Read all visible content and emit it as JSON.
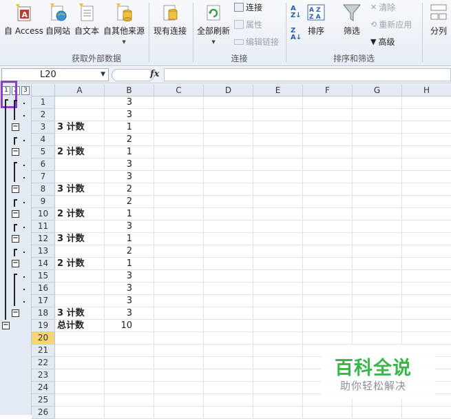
{
  "ribbon": {
    "groups": [
      {
        "label": "获取外部数据"
      },
      {
        "label": "连接"
      },
      {
        "label": "排序和筛选"
      }
    ],
    "buttons": {
      "access": "自 Access",
      "web": "自网站",
      "text": "自文本",
      "other": "自其他来源",
      "existing": "现有连接",
      "refresh_all": "全部刷新",
      "connections": "连接",
      "properties": "属性",
      "edit_links": "编辑链接",
      "sort": "排序",
      "filter": "筛选",
      "clear": "清除",
      "reapply": "重新应用",
      "advanced": "高级",
      "split": "分列"
    }
  },
  "formula_bar": {
    "name_box": "L20",
    "fx": "fx",
    "formula": ""
  },
  "outline": {
    "levels": [
      "1",
      "2",
      "3"
    ]
  },
  "columns": [
    "A",
    "B",
    "C",
    "D",
    "E",
    "F",
    "G",
    "H"
  ],
  "active_row": "20",
  "rows": [
    {
      "num": "1",
      "a": "",
      "b": "3"
    },
    {
      "num": "2",
      "a": "",
      "b": "3"
    },
    {
      "num": "3",
      "a": "3 计数",
      "b": "1"
    },
    {
      "num": "4",
      "a": "",
      "b": "2"
    },
    {
      "num": "5",
      "a": "2 计数",
      "b": "1"
    },
    {
      "num": "6",
      "a": "",
      "b": "3"
    },
    {
      "num": "7",
      "a": "",
      "b": "3"
    },
    {
      "num": "8",
      "a": "3 计数",
      "b": "2"
    },
    {
      "num": "9",
      "a": "",
      "b": "2"
    },
    {
      "num": "10",
      "a": "2 计数",
      "b": "1"
    },
    {
      "num": "11",
      "a": "",
      "b": "3"
    },
    {
      "num": "12",
      "a": "3 计数",
      "b": "1"
    },
    {
      "num": "13",
      "a": "",
      "b": "2"
    },
    {
      "num": "14",
      "a": "2 计数",
      "b": "1"
    },
    {
      "num": "15",
      "a": "",
      "b": "3"
    },
    {
      "num": "16",
      "a": "",
      "b": "3"
    },
    {
      "num": "17",
      "a": "",
      "b": "3"
    },
    {
      "num": "18",
      "a": "3 计数",
      "b": "3"
    },
    {
      "num": "19",
      "a": "总计数",
      "b": "10"
    },
    {
      "num": "20",
      "a": "",
      "b": ""
    },
    {
      "num": "21",
      "a": "",
      "b": ""
    },
    {
      "num": "22",
      "a": "",
      "b": ""
    },
    {
      "num": "23",
      "a": "",
      "b": ""
    },
    {
      "num": "24",
      "a": "",
      "b": ""
    },
    {
      "num": "25",
      "a": "",
      "b": ""
    },
    {
      "num": "26",
      "a": "",
      "b": ""
    }
  ],
  "watermark": {
    "title": "百科全说",
    "subtitle": "助你轻松解决"
  },
  "colors": {
    "highlight_box": "#8e3bd1",
    "active_row_header": "#f8d477",
    "watermark_green": "#39b54a"
  }
}
